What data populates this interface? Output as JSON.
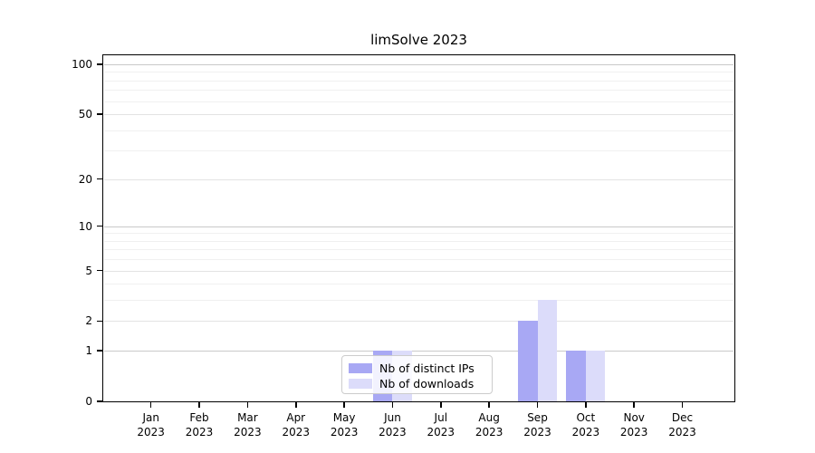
{
  "chart_data": {
    "type": "bar",
    "title": "limSolve 2023",
    "x_categories": [
      "Jan",
      "Feb",
      "Mar",
      "Apr",
      "May",
      "Jun",
      "Jul",
      "Aug",
      "Sep",
      "Oct",
      "Nov",
      "Dec"
    ],
    "x_sub_label": "2023",
    "series": [
      {
        "name": "Nb of distinct IPs",
        "color": "#a8a8f4",
        "values": [
          0,
          0,
          0,
          0,
          0,
          1,
          0,
          0,
          2,
          1,
          0,
          0
        ]
      },
      {
        "name": "Nb of downloads",
        "color": "#dcdcfa",
        "values": [
          0,
          0,
          0,
          0,
          0,
          1,
          0,
          0,
          3,
          1,
          0,
          0
        ]
      }
    ],
    "yscale": "log1p",
    "ylim": [
      0,
      113
    ],
    "ytick_labels": [
      "0",
      "1",
      "2",
      "5",
      "10",
      "20",
      "50",
      "100"
    ],
    "yticks_major": [
      0,
      1,
      2,
      5,
      10,
      20,
      50,
      100
    ],
    "yticks_minor": [
      3,
      4,
      6,
      7,
      8,
      9,
      30,
      40,
      60,
      70,
      80,
      90
    ],
    "grid": true,
    "legend_position": "lower center"
  },
  "colors": {
    "background": "#ffffff",
    "spine": "#000000",
    "grid_decade": "#c9c9c9",
    "grid_labeled": "#e3e3e3",
    "grid_minor": "#f0f0f0",
    "bar_distinct_ips": "#a8a8f4",
    "bar_downloads": "#dcdcfa"
  }
}
